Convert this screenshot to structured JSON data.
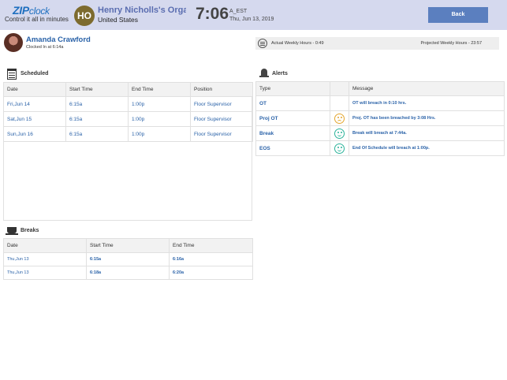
{
  "header": {
    "logo_main": "ZIP",
    "logo_clock": "clock",
    "logo_tagline": "Control it all in minutes",
    "org_initials": "HO",
    "org_name": "Henry Nicholls's Orga...",
    "org_country": "United States",
    "time": "7:06",
    "timezone": "A_EST",
    "date": "Thu, Jun 13, 2019",
    "back_label": "Back"
  },
  "employee": {
    "name": "Amanda Crawford",
    "status": "Clocked In at 6:14a"
  },
  "hours": {
    "actual": "Actual Weekly Hours - 0:49",
    "projected": "Projected Weekly Hours - 23:57"
  },
  "scheduled": {
    "title": "Scheduled",
    "columns": [
      "Date",
      "Start Time",
      "End Time",
      "Position"
    ],
    "rows": [
      [
        "Fri,Jun 14",
        "6:15a",
        "1:00p",
        "Floor Supervisor"
      ],
      [
        "Sat,Jun 15",
        "6:15a",
        "1:00p",
        "Floor Supervisor"
      ],
      [
        "Sun,Jun 16",
        "6:15a",
        "1:00p",
        "Floor Supervisor"
      ]
    ]
  },
  "alerts": {
    "title": "Alerts",
    "columns": [
      "Type",
      "Message"
    ],
    "rows": [
      {
        "type": "OT",
        "icon": "none",
        "message": "OT will breach in 0:10 hrs."
      },
      {
        "type": "Proj OT",
        "icon": "sad-face-icon",
        "message": "Proj. OT has been breached by 3:08 Hrs."
      },
      {
        "type": "Break",
        "icon": "happy-face-icon",
        "message": "Break will breach at 7:44a."
      },
      {
        "type": "EOS",
        "icon": "happy-face-icon",
        "message": "End Of Schedule will breach at 1:00p."
      }
    ]
  },
  "breaks": {
    "title": "Breaks",
    "columns": [
      "Date",
      "Start Time",
      "End Time"
    ],
    "rows": [
      [
        "Thu,Jun 13",
        "6:15a",
        "6:16a"
      ],
      [
        "Thu,Jun 13",
        "6:18a",
        "6:20a"
      ]
    ]
  },
  "colors": {
    "header_bg": "#d5d9ee",
    "accent_blue": "#2a62a8",
    "back_button": "#5b7fbf",
    "happy": "#2bb39a",
    "sad": "#e4a62e"
  }
}
